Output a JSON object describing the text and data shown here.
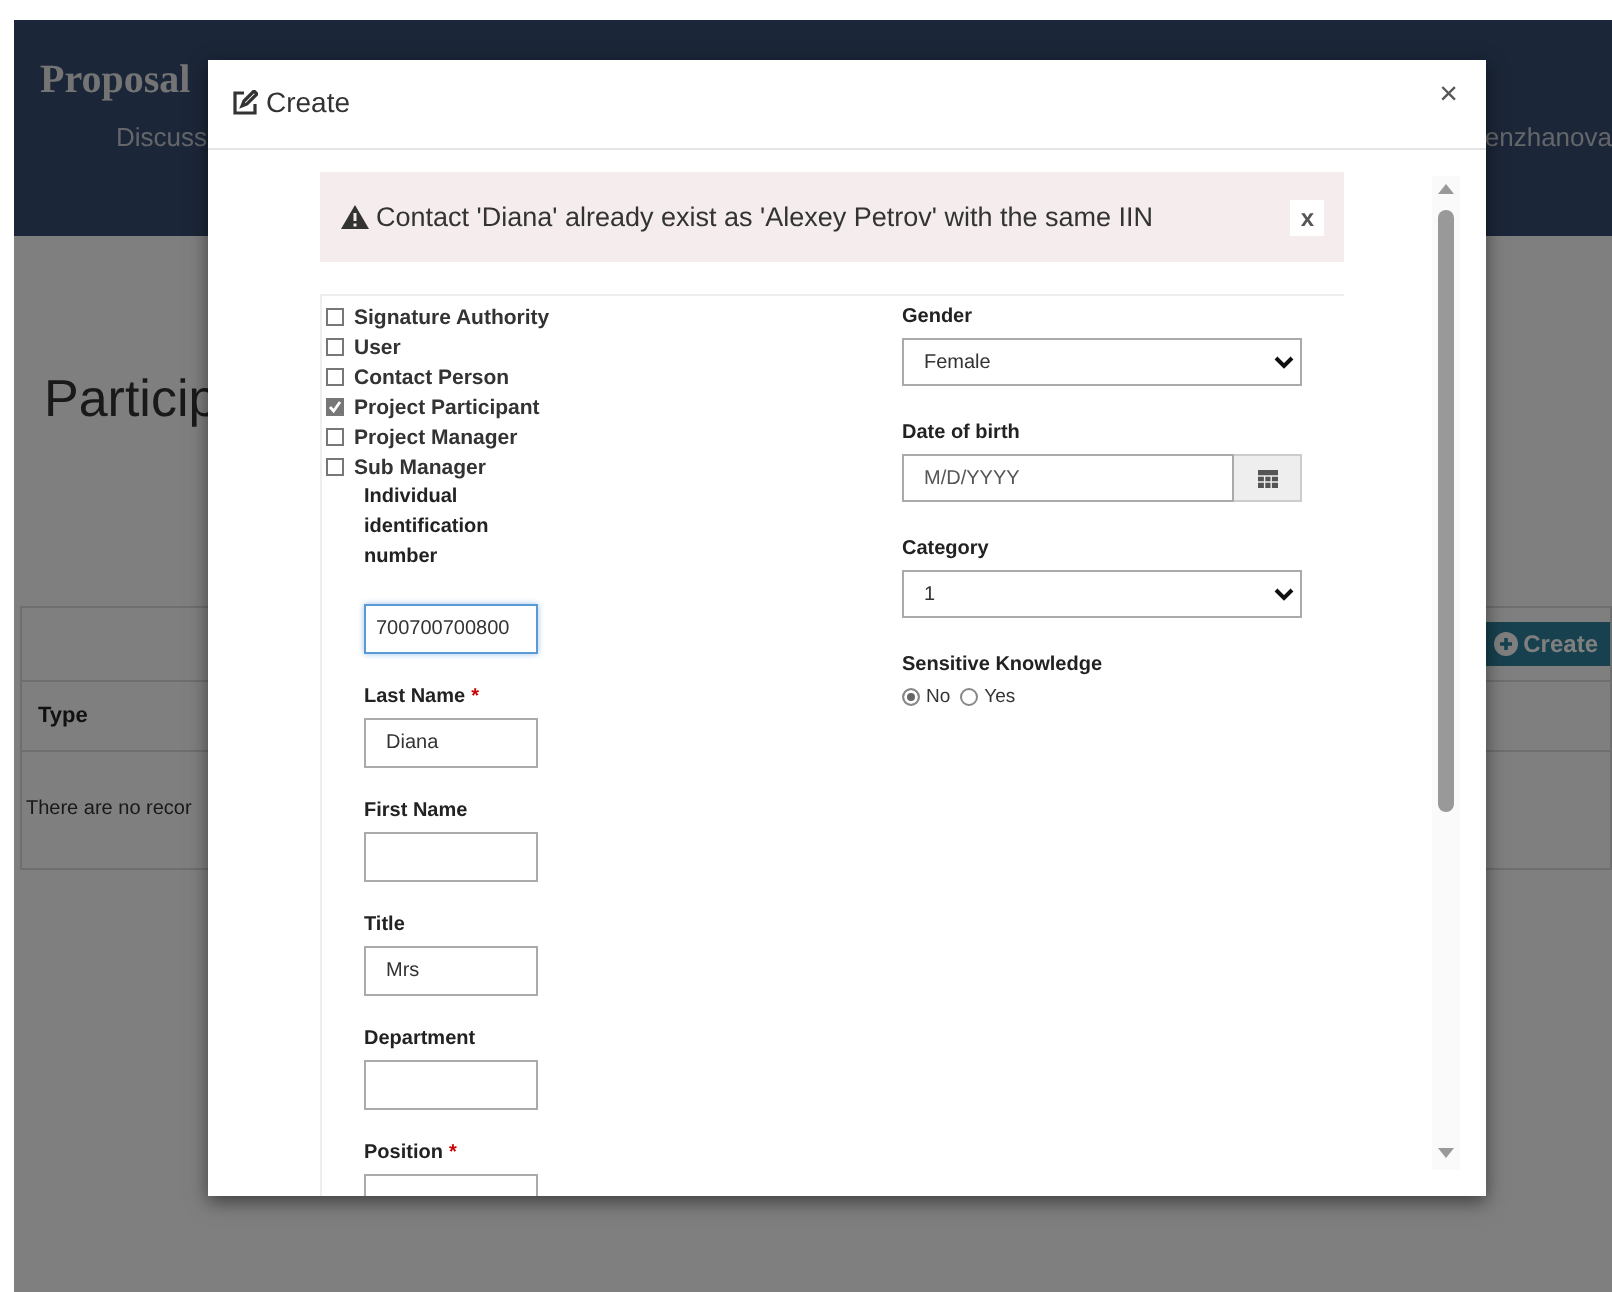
{
  "background_page": {
    "title": "Proposal",
    "nav_left": "Discuss",
    "nav_right": "enzhanova",
    "heading": "Particip",
    "create_button": "Create",
    "table": {
      "columns": [
        "Type"
      ],
      "empty_message": "There are no recor"
    }
  },
  "dialog": {
    "title": "Create",
    "close": "×",
    "required_marker": "*",
    "alert": {
      "message": "Contact 'Diana' already exist as 'Alexey Petrov' with the same IIN",
      "dismiss": "x"
    },
    "roles": [
      {
        "label": "Signature Authority",
        "checked": false
      },
      {
        "label": "User",
        "checked": false
      },
      {
        "label": "Contact Person",
        "checked": false
      },
      {
        "label": "Project Participant",
        "checked": true
      },
      {
        "label": "Project Manager",
        "checked": false
      },
      {
        "label": "Sub Manager",
        "checked": false
      }
    ],
    "left_fields": [
      {
        "label": "Individual identification number",
        "value": "700700700800",
        "required": false,
        "focused": true
      },
      {
        "label": "Last Name",
        "value": "Diana",
        "required": true,
        "focused": false
      },
      {
        "label": "First Name",
        "required": false,
        "focused": false
      },
      {
        "label": "Title",
        "value": "Mrs",
        "required": false,
        "focused": false
      },
      {
        "label": "Department",
        "required": false,
        "focused": false
      },
      {
        "label": "Position",
        "required": true,
        "focused": false
      }
    ],
    "right_fields": [
      {
        "label": "Gender",
        "kind": "select",
        "value": "Female"
      },
      {
        "label": "Date of birth",
        "kind": "date",
        "placeholder": "M/D/YYYY"
      },
      {
        "label": "Category",
        "kind": "select",
        "value": "1"
      },
      {
        "label": "Sensitive Knowledge",
        "kind": "radio",
        "options": [
          {
            "label": "No",
            "selected": true
          },
          {
            "label": "Yes",
            "selected": false
          }
        ]
      }
    ]
  }
}
